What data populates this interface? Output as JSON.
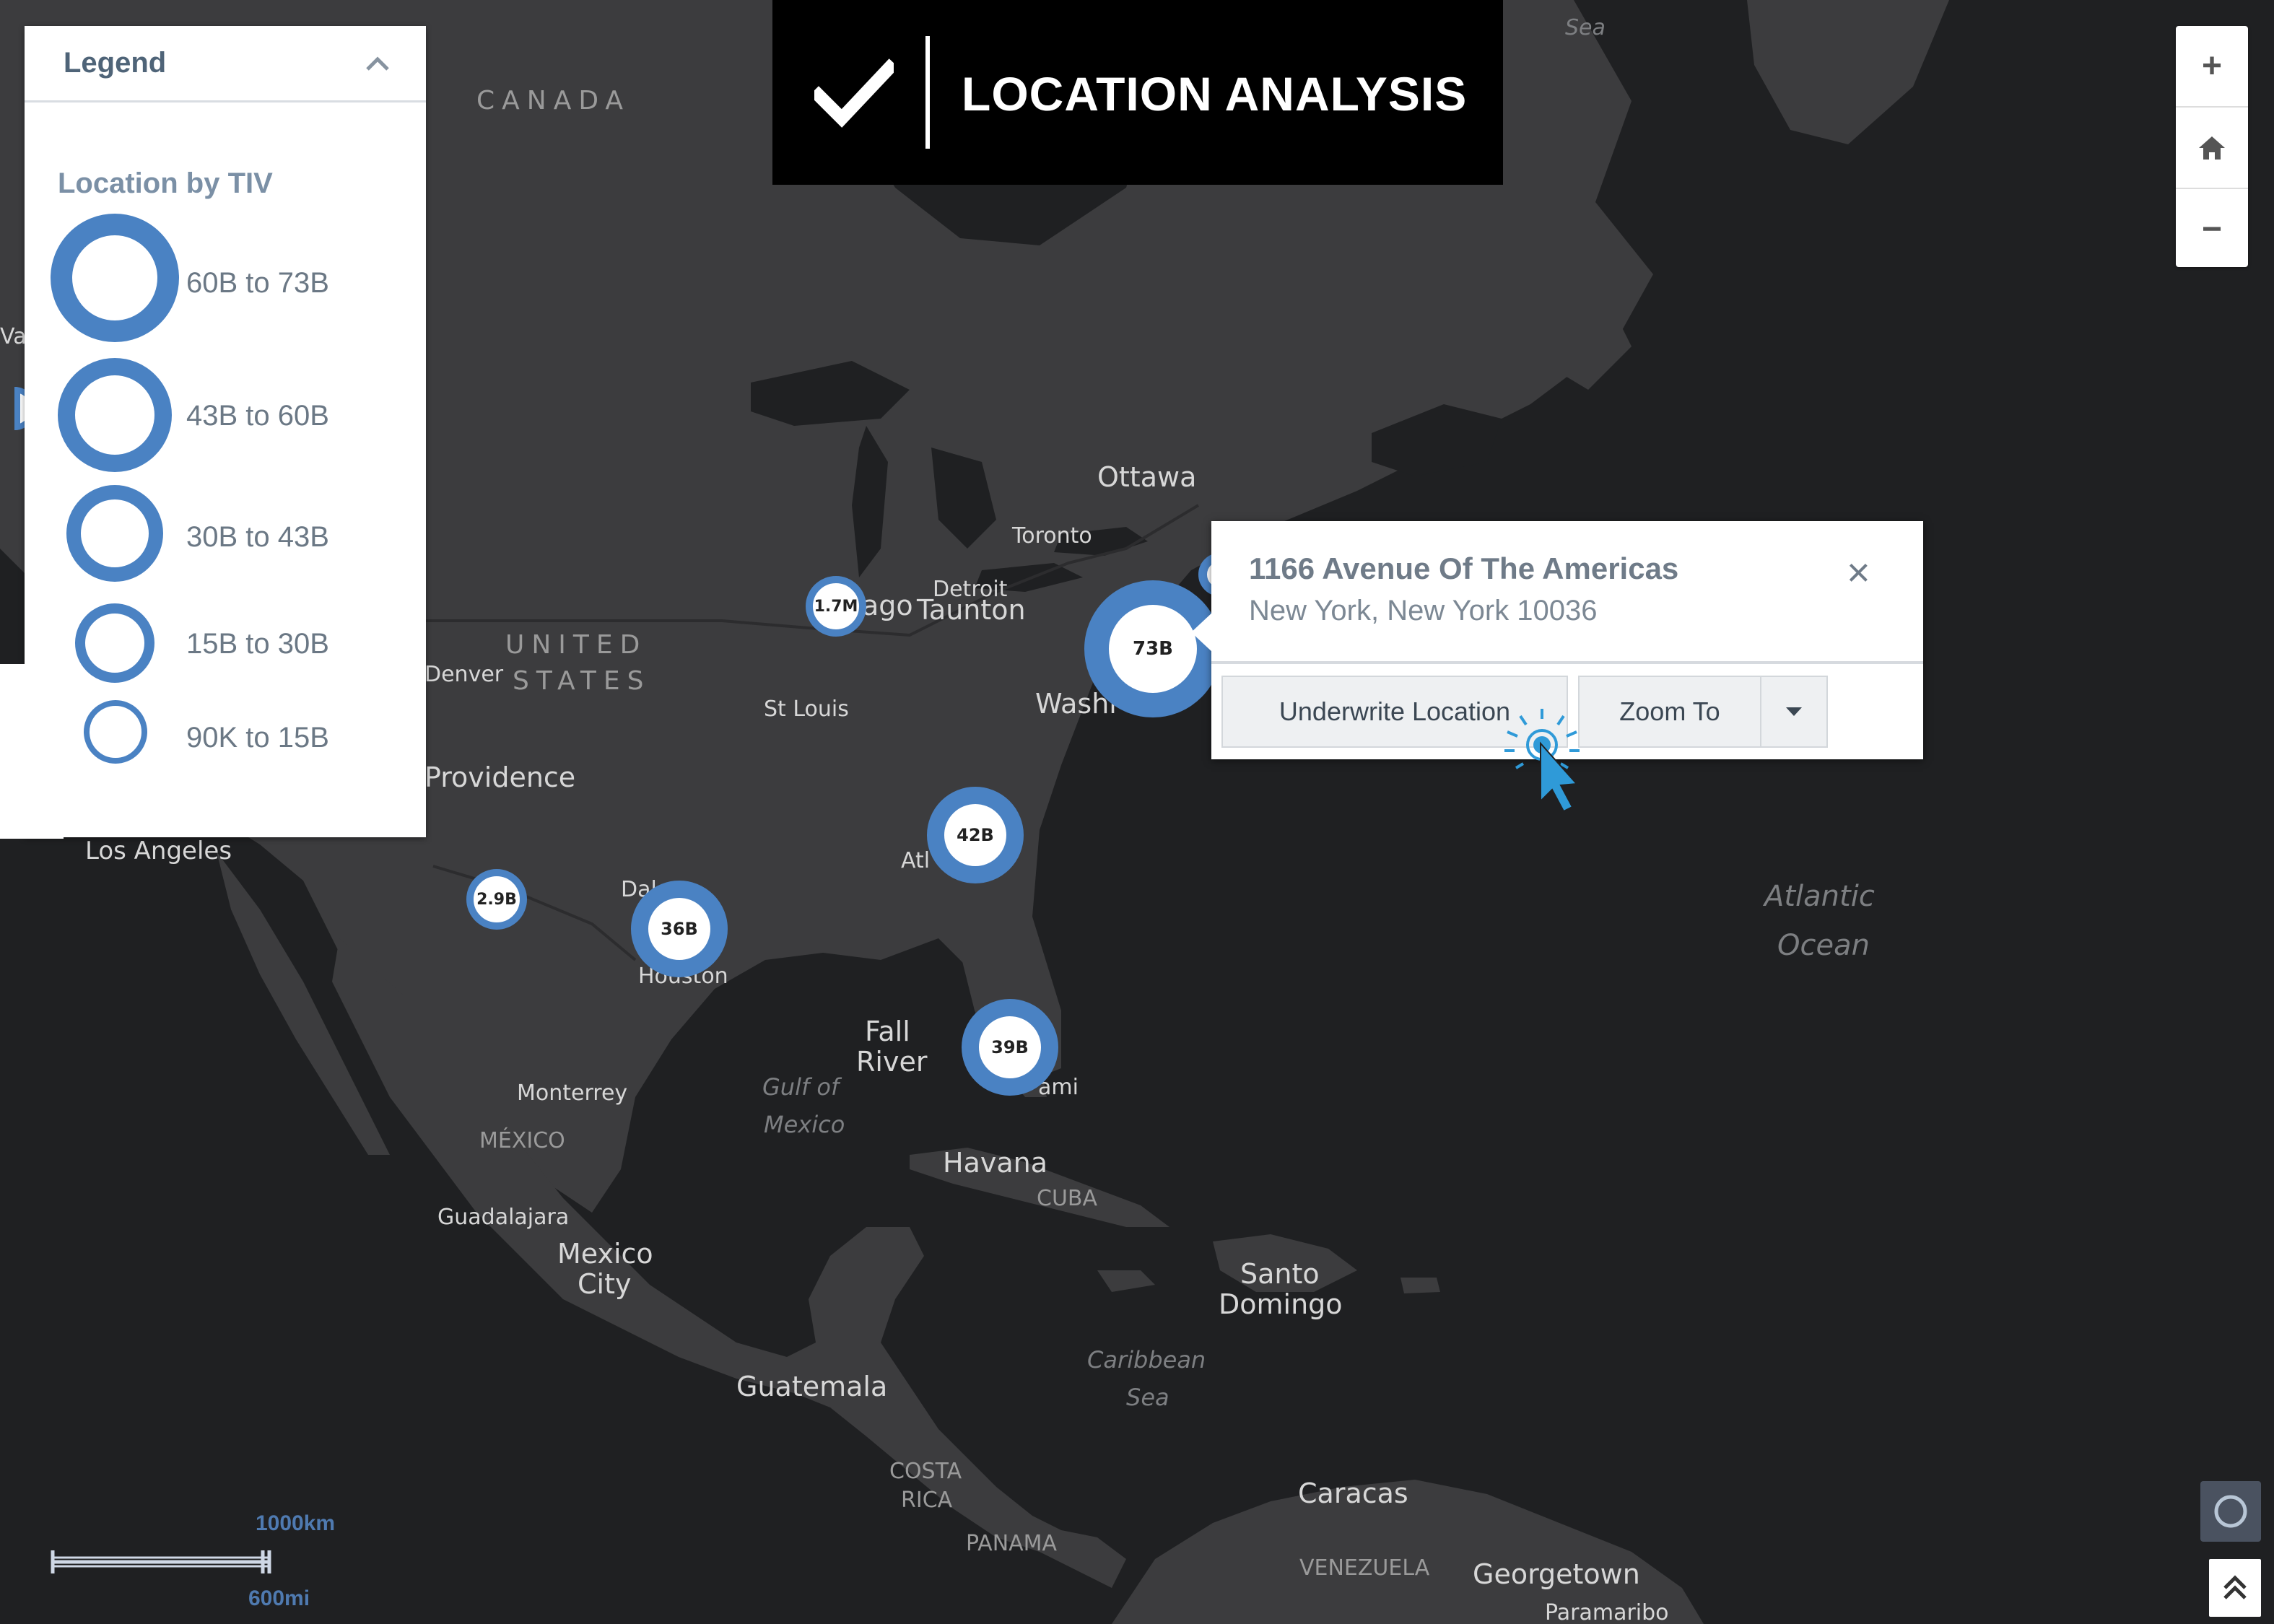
{
  "banner": {
    "title": "LOCATION ANALYSIS",
    "icon": "check-icon"
  },
  "legend": {
    "title": "Legend",
    "subtitle": "Location by TIV",
    "items": [
      {
        "label": "60B to 73B"
      },
      {
        "label": "43B to 60B"
      },
      {
        "label": "30B to 43B"
      },
      {
        "label": "15B to 30B"
      },
      {
        "label": "90K to 15B"
      }
    ],
    "accent": "#4a82c3"
  },
  "map": {
    "labels": [
      "CANADA",
      "UNITED",
      "STATES",
      "MÉXICO",
      "CUBA",
      "COSTA",
      "RICA",
      "PANAMA",
      "VENEZUELA",
      "Ottawa",
      "Toronto",
      "Detroit",
      "Taunton",
      "ago",
      "Washi",
      "St Louis",
      "Denver",
      "Providence",
      "Los Angeles",
      "Dal",
      "Houston",
      "Atl",
      "Fall",
      "River",
      "ami",
      "Monterrey",
      "Guadalajara",
      "Mexico",
      "City",
      "Havana",
      "Santo",
      "Domingo",
      "Guatemala",
      "Caracas",
      "Georgetown",
      "Paramaribo",
      "Gulf of",
      "Mexico",
      "Caribbean",
      "Sea",
      "Atlantic",
      "Ocean",
      "Sea",
      "Var"
    ],
    "clusters": [
      {
        "label": "73B"
      },
      {
        "label": "42B"
      },
      {
        "label": "39B"
      },
      {
        "label": "36B"
      },
      {
        "label": "2.9B"
      },
      {
        "label": "1.7M"
      }
    ]
  },
  "popup": {
    "address_line1": "1166 Avenue Of The Americas",
    "address_line2": "New York, New York 10036",
    "close": "×",
    "underwrite_label": "Underwrite Location",
    "zoomto_label": "Zoom To"
  },
  "zoom": {
    "in": "+",
    "home": "home-icon",
    "out": "−"
  },
  "scale": {
    "km": "1000km",
    "mi": "600mi"
  }
}
